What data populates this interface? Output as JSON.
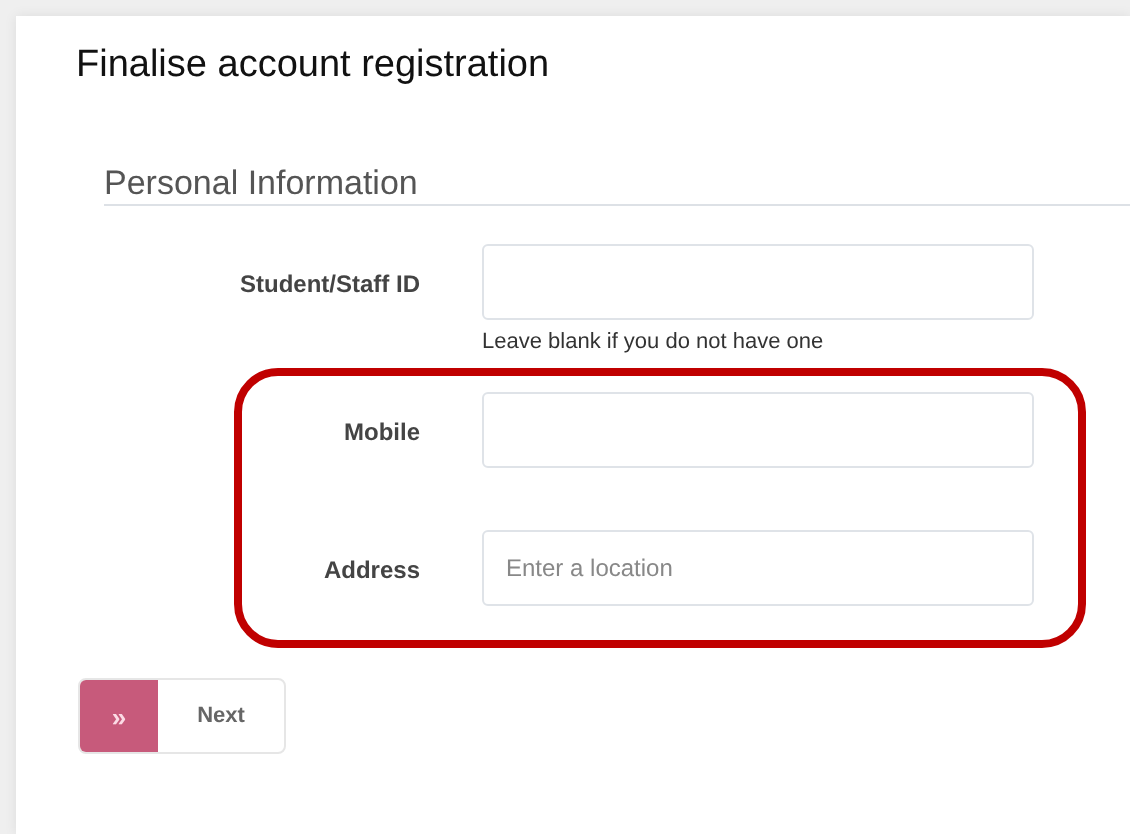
{
  "title": "Finalise account registration",
  "section": "Personal Information",
  "fields": [
    {
      "label": "Student/Staff ID",
      "help": "Leave blank if you do not have one",
      "highlighted": false
    },
    {
      "label": "Mobile",
      "highlighted": true
    },
    {
      "label": "Address",
      "placeholder": "Enter a location",
      "highlighted": true
    }
  ],
  "next_button": {
    "icon": "»",
    "label": "Next"
  }
}
